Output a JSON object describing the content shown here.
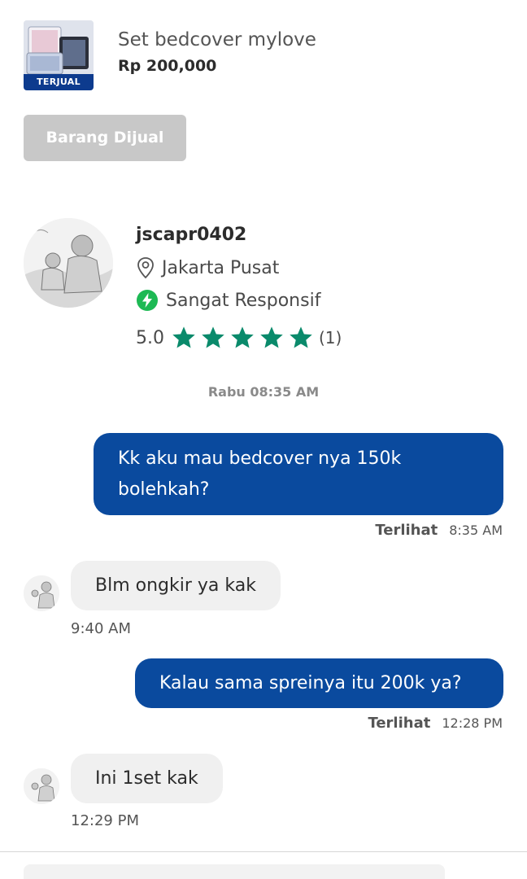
{
  "product": {
    "title": "Set bedcover mylove",
    "price": "Rp 200,000",
    "badge": "TERJUAL",
    "thumbnail_icon": "bedcover-photo"
  },
  "sold_button": {
    "label": "Barang Dijual"
  },
  "seller": {
    "username": "jscapr0402",
    "location": "Jakarta Pusat",
    "responsiveness": "Sangat Responsif",
    "rating": "5.0",
    "stars": 5,
    "review_count": "(1)",
    "colors": {
      "star": "#0a8a6b",
      "bolt": "#1db954"
    }
  },
  "chat": {
    "date_divider": "Rabu 08:35 AM",
    "messages": [
      {
        "direction": "out",
        "line1": "Kk aku mau bedcover nya 150k",
        "line2": "bolehkah?",
        "status": "Terlihat",
        "time": "8:35 AM"
      },
      {
        "direction": "in",
        "text": "Blm ongkir ya kak",
        "time": "9:40 AM"
      },
      {
        "direction": "out",
        "text": "Kalau sama spreinya itu 200k ya?",
        "status": "Terlihat",
        "time": "12:28 PM"
      },
      {
        "direction": "in",
        "text": "Ini 1set kak",
        "time": "12:29 PM"
      }
    ]
  },
  "colors": {
    "outgoing_bubble": "#0a4a9e",
    "incoming_bubble": "#f0f0f0",
    "badge": "#0d3b8e",
    "disabled_button": "#c8c8c8"
  }
}
